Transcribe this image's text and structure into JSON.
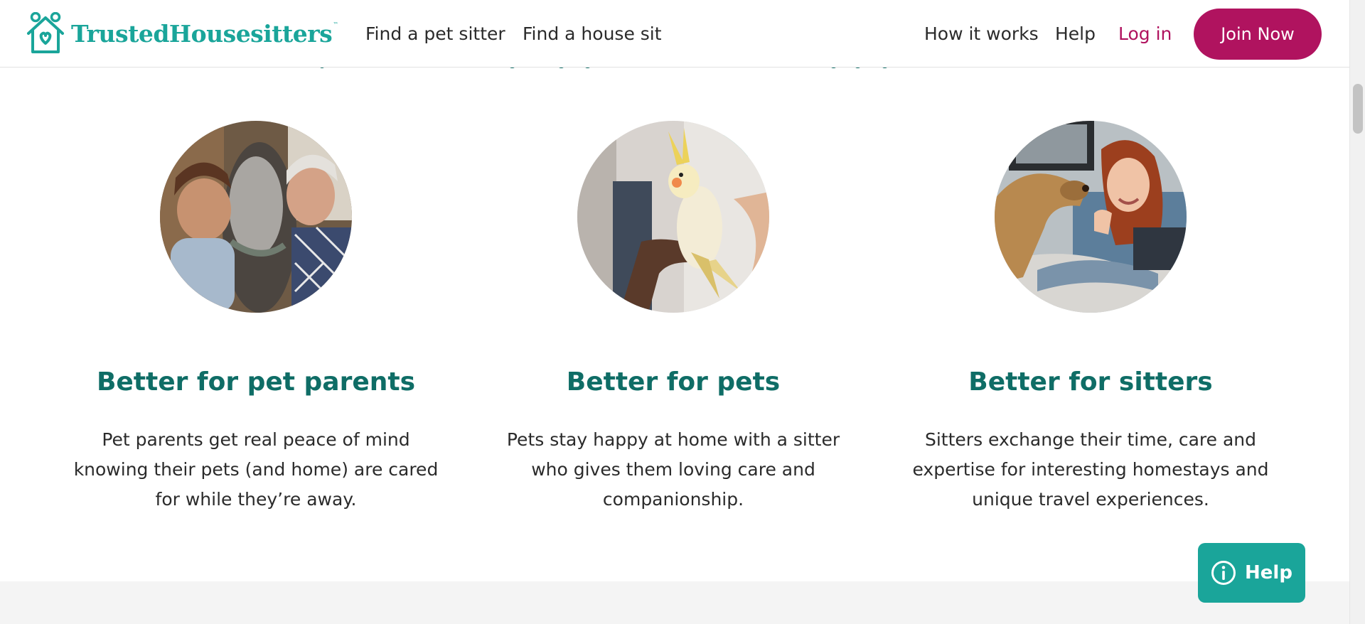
{
  "header": {
    "logo_text": "TrustedHousesitters",
    "logo_tm": "™",
    "nav_left": [
      "Find a pet sitter",
      "Find a house sit"
    ],
    "nav_right": [
      "How it works",
      "Help"
    ],
    "login_label": "Log in",
    "join_label": "Join Now"
  },
  "features": [
    {
      "title": "Better for pet parents",
      "body": "Pet parents get real peace of mind knowing their pets (and home) are cared for while they’re away.",
      "image_icon": "horse-owners-photo"
    },
    {
      "title": "Better for pets",
      "body": "Pets stay happy at home with a sitter who gives them loving care and companionship.",
      "image_icon": "cockatiel-photo"
    },
    {
      "title": "Better for sitters",
      "body": "Sitters exchange their time, care and expertise for interesting homestays and unique travel experiences.",
      "image_icon": "dog-and-woman-photo"
    }
  ],
  "help_fab": {
    "label": "Help",
    "icon": "info-icon"
  },
  "colors": {
    "brand_teal": "#1aa59a",
    "heading_teal": "#0f6d66",
    "accent_magenta": "#b0135f",
    "text": "#2b2b2b",
    "band_grey": "#f4f4f4"
  }
}
